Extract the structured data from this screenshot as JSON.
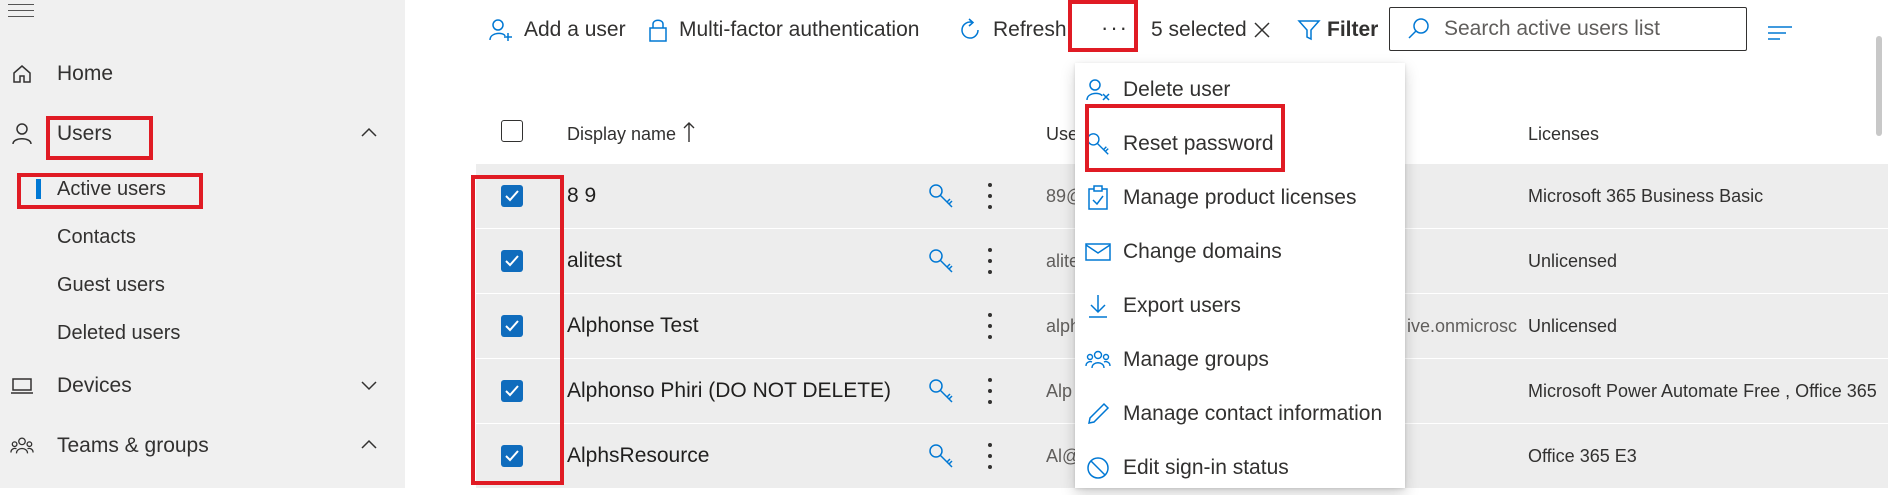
{
  "sidebar": {
    "home": "Home",
    "users": "Users",
    "users_sub": [
      "Active users",
      "Contacts",
      "Guest users",
      "Deleted users"
    ],
    "devices": "Devices",
    "teams": "Teams & groups"
  },
  "toolbar": {
    "add_user": "Add a user",
    "mfa": "Multi-factor authentication",
    "refresh": "Refresh",
    "more": "···",
    "selected_count": "5 selected",
    "filter": "Filter",
    "search_placeholder": "Search active users list"
  },
  "grid": {
    "col_display_name": "Display name",
    "col_username": "Use",
    "col_licenses": "Licenses",
    "rows": [
      {
        "name": "8 9",
        "username": "89@",
        "licenses": "Microsoft 365 Business Basic"
      },
      {
        "name": "alitest",
        "username": "alite",
        "licenses": "Unlicensed"
      },
      {
        "name": "Alphonse Test",
        "username": "alph",
        "username_tail": "ive.onmicrosc",
        "licenses": "Unlicensed"
      },
      {
        "name": "Alphonso Phiri (DO NOT DELETE)",
        "username": "Alp",
        "licenses": "Microsoft Power Automate Free , Office 365"
      },
      {
        "name": "AlphsResource",
        "username": "Al@",
        "licenses": "Office 365 E3"
      }
    ]
  },
  "menu": {
    "items": [
      "Delete user",
      "Reset password",
      "Manage product licenses",
      "Change domains",
      "Export users",
      "Manage groups",
      "Manage contact information",
      "Edit sign-in status"
    ]
  },
  "colors": {
    "accent": "#0078d4",
    "checkbox": "#0f6cbd",
    "highlight_box": "#e01b24",
    "row_bg": "#ededed",
    "sidebar_bg": "#f0f0f0"
  }
}
